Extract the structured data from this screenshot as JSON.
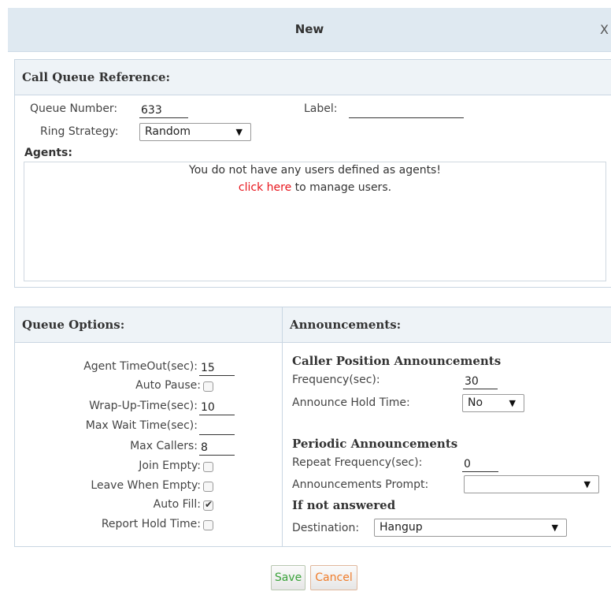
{
  "dialog": {
    "title": "New",
    "close": "X"
  },
  "reference": {
    "header": "Call Queue Reference:",
    "queue_number_label": "Queue Number:",
    "queue_number_value": "633",
    "label_label": "Label:",
    "label_value": "",
    "ring_strategy_label": "Ring Strategy:",
    "ring_strategy_value": "Random",
    "agents_label": "Agents:",
    "agents_message": "You do not have any users defined as agents!",
    "agents_link": "click here",
    "agents_link_suffix": " to manage users."
  },
  "queue_options": {
    "header": "Queue Options:",
    "agent_timeout_label": "Agent TimeOut(sec):",
    "agent_timeout_value": "15",
    "auto_pause_label": "Auto Pause:",
    "auto_pause_checked": false,
    "wrap_up_label": "Wrap-Up-Time(sec):",
    "wrap_up_value": "10",
    "max_wait_label": "Max Wait Time(sec):",
    "max_wait_value": "",
    "max_callers_label": "Max Callers:",
    "max_callers_value": "8",
    "join_empty_label": "Join Empty:",
    "join_empty_checked": false,
    "leave_when_empty_label": "Leave When Empty:",
    "leave_when_empty_checked": false,
    "auto_fill_label": "Auto Fill:",
    "auto_fill_checked": true,
    "report_hold_time_label": "Report Hold Time:",
    "report_hold_time_checked": false
  },
  "announcements": {
    "header": "Announcements:",
    "caller_position_heading": "Caller Position Announcements",
    "frequency_label": "Frequency(sec):",
    "frequency_value": "30",
    "announce_hold_label": "Announce Hold Time:",
    "announce_hold_value": "No",
    "periodic_heading": "Periodic Announcements",
    "repeat_frequency_label": "Repeat Frequency(sec):",
    "repeat_frequency_value": "0",
    "prompt_label": "Announcements Prompt:",
    "prompt_value": "",
    "if_not_answered_heading": "If not answered",
    "destination_label": "Destination:",
    "destination_value": "Hangup"
  },
  "buttons": {
    "save": "Save",
    "cancel": "Cancel"
  },
  "colors": {
    "link_red": "#e8141b",
    "save_green": "#3aa33a",
    "cancel_orange": "#f07c2a",
    "header_bg": "#dfe9f1",
    "panel_head_bg": "#eef3f7"
  }
}
